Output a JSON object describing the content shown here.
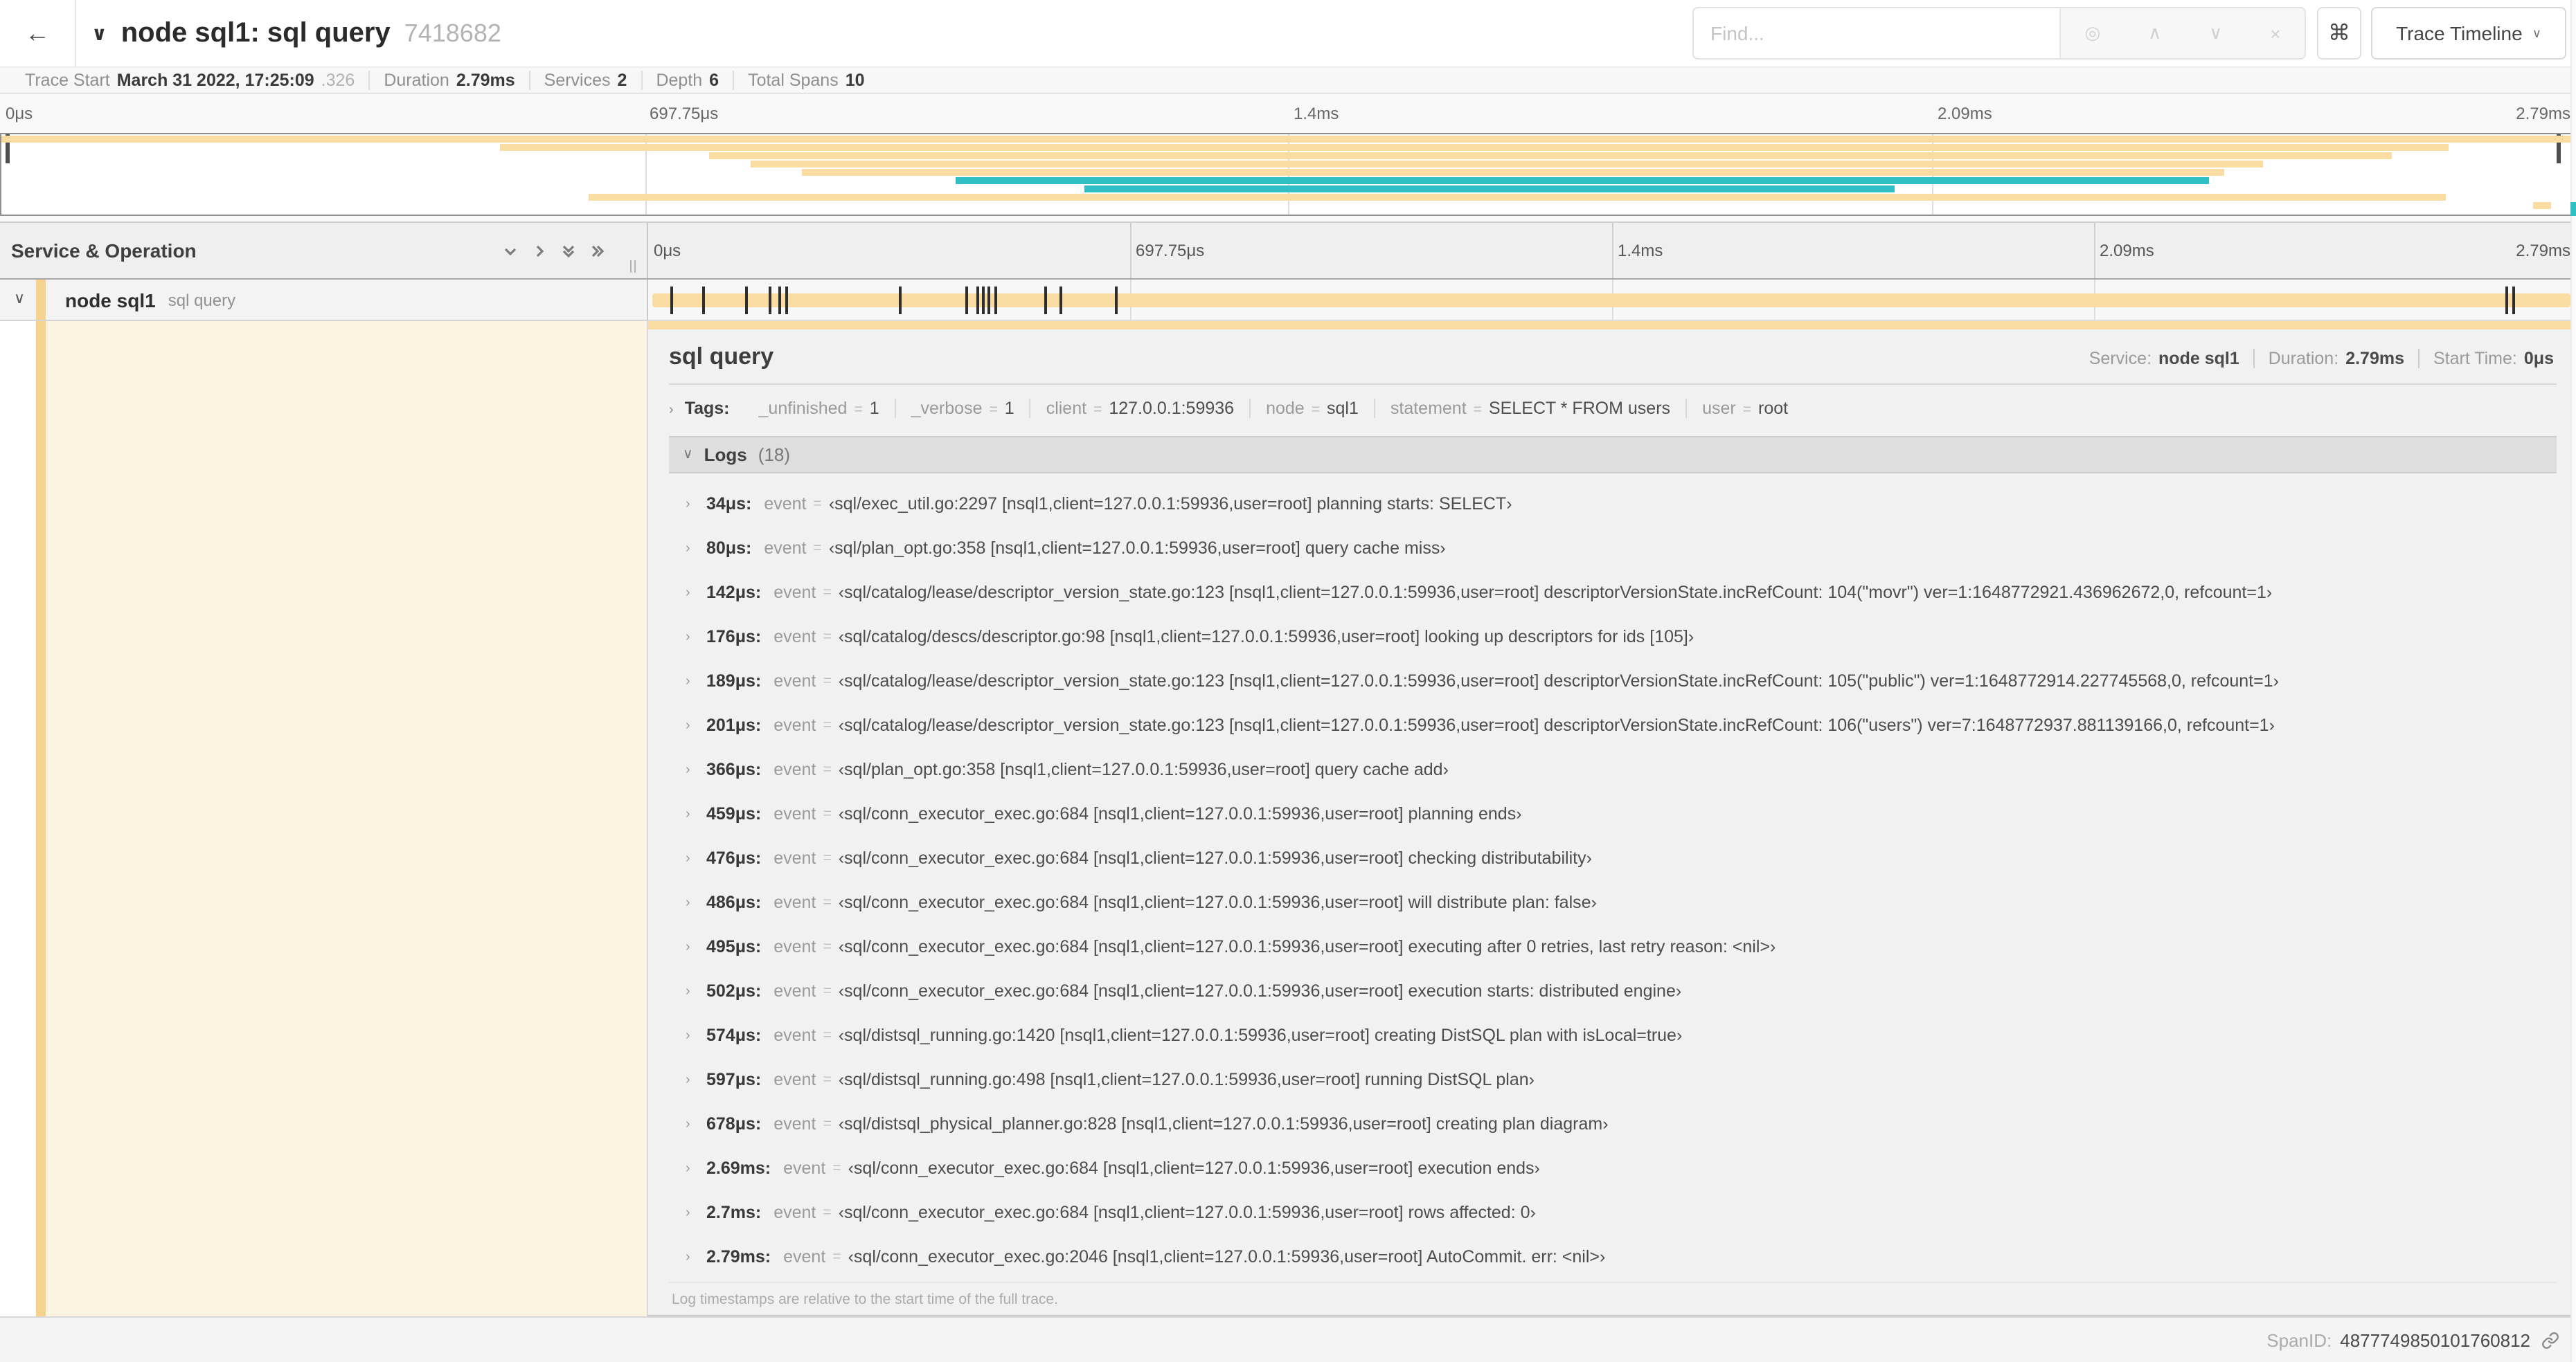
{
  "colors": {
    "tan": "#F8DCA1",
    "teal": "#2FC0C5",
    "accent": "#F5D28E"
  },
  "icons": {
    "back": "←",
    "chevron_down": "∨",
    "caret": "∨",
    "command": "⌘",
    "target": "◎",
    "up": "∧",
    "down": "∨",
    "clear": "×",
    "expand": "›"
  },
  "header": {
    "title": "node sql1: sql query",
    "trace_id": "7418682",
    "find_placeholder": "Find...",
    "view_label": "Trace Timeline"
  },
  "summary": {
    "items": [
      {
        "label": "Trace Start",
        "value": "March 31 2022, 17:25:09",
        "suffix": ".326"
      },
      {
        "label": "Duration",
        "value": "2.79ms"
      },
      {
        "label": "Services",
        "value": "2"
      },
      {
        "label": "Depth",
        "value": "6"
      },
      {
        "label": "Total Spans",
        "value": "10"
      }
    ]
  },
  "timeline": {
    "column_header": "Service & Operation",
    "ticks": [
      {
        "label": "0μs",
        "pct": 0
      },
      {
        "label": "697.75μs",
        "pct": 25
      },
      {
        "label": "1.4ms",
        "pct": 50
      },
      {
        "label": "2.09ms",
        "pct": 75
      },
      {
        "label": "2.79ms",
        "pct": 100
      }
    ]
  },
  "minimap": {
    "spans": [
      {
        "row": 0,
        "left": 0,
        "width": 100,
        "color": "tan"
      },
      {
        "row": 1,
        "left": 19.4,
        "width": 75.7,
        "color": "tan"
      },
      {
        "row": 2,
        "left": 27.5,
        "width": 65.4,
        "color": "tan"
      },
      {
        "row": 3,
        "left": 29.1,
        "width": 58.8,
        "color": "tan"
      },
      {
        "row": 4,
        "left": 31.1,
        "width": 55.3,
        "color": "tan"
      },
      {
        "row": 5,
        "left": 37.1,
        "width": 48.7,
        "color": "teal"
      },
      {
        "row": 6,
        "left": 42.1,
        "width": 31.5,
        "color": "teal"
      },
      {
        "row": 7,
        "left": 22.8,
        "width": 72.2,
        "color": "tan"
      },
      {
        "row": 8,
        "left": 98.4,
        "width": 0.7,
        "color": "tan"
      }
    ]
  },
  "span_row": {
    "service": "node sql1",
    "operation": "sql query",
    "log_marker_pcts": [
      1.2,
      2.9,
      5.1,
      6.3,
      6.8,
      7.2,
      13.1,
      16.5,
      17.1,
      17.4,
      17.7,
      18.0,
      20.6,
      21.4,
      24.3,
      96.4,
      96.8,
      99.8
    ]
  },
  "detail": {
    "title": "sql query",
    "info": [
      {
        "label": "Service:",
        "value": "node sql1"
      },
      {
        "label": "Duration:",
        "value": "2.79ms"
      },
      {
        "label": "Start Time:",
        "value": "0μs"
      }
    ],
    "tags_label": "Tags:",
    "tags": [
      {
        "key": "_unfinished",
        "value": "1"
      },
      {
        "key": "_verbose",
        "value": "1"
      },
      {
        "key": "client",
        "value": "127.0.0.1:59936"
      },
      {
        "key": "node",
        "value": "sql1"
      },
      {
        "key": "statement",
        "value": "SELECT * FROM users"
      },
      {
        "key": "user",
        "value": "root"
      }
    ],
    "logs_label": "Logs",
    "logs_count": "(18)",
    "logs": [
      {
        "time": "34μs:",
        "key": "event",
        "value": "‹sql/exec_util.go:2297 [nsql1,client=127.0.0.1:59936,user=root] planning starts: SELECT›"
      },
      {
        "time": "80μs:",
        "key": "event",
        "value": "‹sql/plan_opt.go:358 [nsql1,client=127.0.0.1:59936,user=root] query cache miss›"
      },
      {
        "time": "142μs:",
        "key": "event",
        "value": "‹sql/catalog/lease/descriptor_version_state.go:123 [nsql1,client=127.0.0.1:59936,user=root] descriptorVersionState.incRefCount: 104(\"movr\") ver=1:1648772921.436962672,0, refcount=1›"
      },
      {
        "time": "176μs:",
        "key": "event",
        "value": "‹sql/catalog/descs/descriptor.go:98 [nsql1,client=127.0.0.1:59936,user=root] looking up descriptors for ids [105]›"
      },
      {
        "time": "189μs:",
        "key": "event",
        "value": "‹sql/catalog/lease/descriptor_version_state.go:123 [nsql1,client=127.0.0.1:59936,user=root] descriptorVersionState.incRefCount: 105(\"public\") ver=1:1648772914.227745568,0, refcount=1›"
      },
      {
        "time": "201μs:",
        "key": "event",
        "value": "‹sql/catalog/lease/descriptor_version_state.go:123 [nsql1,client=127.0.0.1:59936,user=root] descriptorVersionState.incRefCount: 106(\"users\") ver=7:1648772937.881139166,0, refcount=1›"
      },
      {
        "time": "366μs:",
        "key": "event",
        "value": "‹sql/plan_opt.go:358 [nsql1,client=127.0.0.1:59936,user=root] query cache add›"
      },
      {
        "time": "459μs:",
        "key": "event",
        "value": "‹sql/conn_executor_exec.go:684 [nsql1,client=127.0.0.1:59936,user=root] planning ends›"
      },
      {
        "time": "476μs:",
        "key": "event",
        "value": "‹sql/conn_executor_exec.go:684 [nsql1,client=127.0.0.1:59936,user=root] checking distributability›"
      },
      {
        "time": "486μs:",
        "key": "event",
        "value": "‹sql/conn_executor_exec.go:684 [nsql1,client=127.0.0.1:59936,user=root] will distribute plan: false›"
      },
      {
        "time": "495μs:",
        "key": "event",
        "value": "‹sql/conn_executor_exec.go:684 [nsql1,client=127.0.0.1:59936,user=root] executing after 0 retries, last retry reason: <nil>›"
      },
      {
        "time": "502μs:",
        "key": "event",
        "value": "‹sql/conn_executor_exec.go:684 [nsql1,client=127.0.0.1:59936,user=root] execution starts: distributed engine›"
      },
      {
        "time": "574μs:",
        "key": "event",
        "value": "‹sql/distsql_running.go:1420 [nsql1,client=127.0.0.1:59936,user=root] creating DistSQL plan with isLocal=true›"
      },
      {
        "time": "597μs:",
        "key": "event",
        "value": "‹sql/distsql_running.go:498 [nsql1,client=127.0.0.1:59936,user=root] running DistSQL plan›"
      },
      {
        "time": "678μs:",
        "key": "event",
        "value": "‹sql/distsql_physical_planner.go:828 [nsql1,client=127.0.0.1:59936,user=root] creating plan diagram›"
      },
      {
        "time": "2.69ms:",
        "key": "event",
        "value": "‹sql/conn_executor_exec.go:684 [nsql1,client=127.0.0.1:59936,user=root] execution ends›"
      },
      {
        "time": "2.7ms:",
        "key": "event",
        "value": "‹sql/conn_executor_exec.go:684 [nsql1,client=127.0.0.1:59936,user=root] rows affected: 0›"
      },
      {
        "time": "2.79ms:",
        "key": "event",
        "value": "‹sql/conn_executor_exec.go:2046 [nsql1,client=127.0.0.1:59936,user=root] AutoCommit. err: <nil>›"
      }
    ],
    "footnote": "Log timestamps are relative to the start time of the full trace.",
    "span_id_label": "SpanID:",
    "span_id": "4877749850101760812"
  }
}
